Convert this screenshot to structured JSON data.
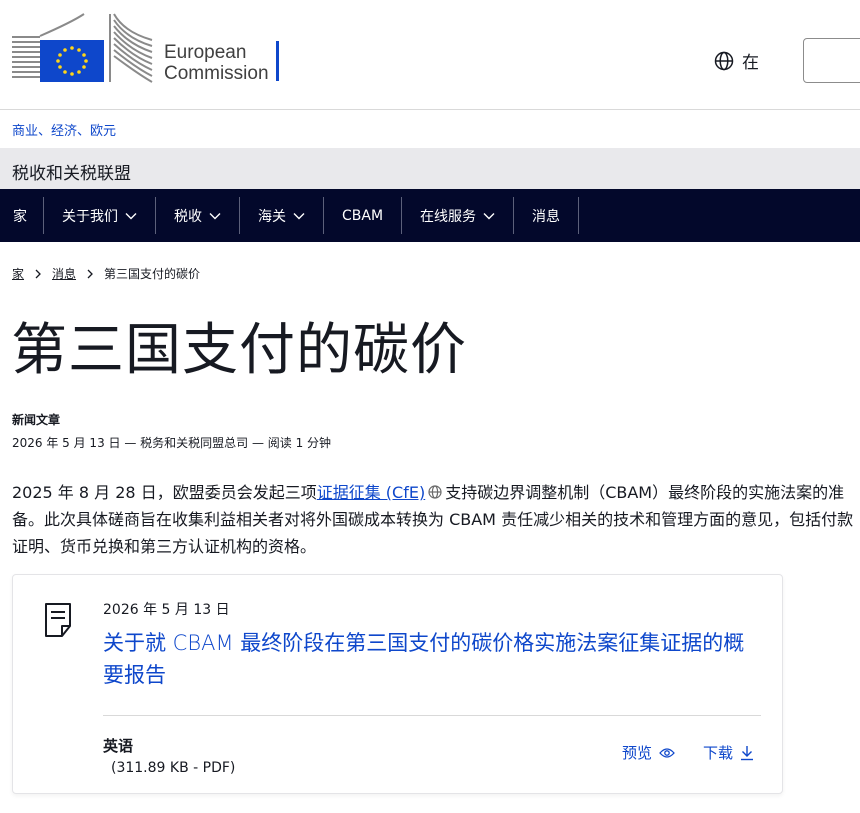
{
  "header": {
    "logo_line1": "European",
    "logo_line2": "Commission",
    "language_label": "在",
    "search_placeholder": ""
  },
  "site": {
    "parent_link": "商业、经济、欧元",
    "name": "税收和关税联盟"
  },
  "nav": {
    "items": [
      {
        "label": "家"
      },
      {
        "label": "关于我们"
      },
      {
        "label": "税收"
      },
      {
        "label": "海关"
      },
      {
        "label": "CBAM"
      },
      {
        "label": "在线服务"
      },
      {
        "label": "消息"
      }
    ]
  },
  "breadcrumb": {
    "home": "家",
    "news": "消息",
    "current": "第三国支付的碳价"
  },
  "article": {
    "title": "第三国支付的碳价",
    "type": "新闻文章",
    "meta": "2026 年 5 月 13 日 — 税务和关税同盟总司 — 阅读 1 分钟",
    "intro_before": "2025 年 8 月 28 日，欧盟委员会发起三项",
    "intro_link": "证据征集 (CfE)",
    "intro_after": "支持碳边界调整机制（CBAM）最终阶段的实施法案的准备。此次具体磋商旨在收集利益相关者对将外国碳成本转换为 CBAM 责任减少相关的技术和管理方面的意见，包括付款证明、货币兑换和第三方认证机构的资格。"
  },
  "file_card": {
    "date": "2026 年 5 月 13 日",
    "title": "关于就 CBAM 最终阶段在第三国支付的碳价格实施法案征集证据的概要报告",
    "language": "英语",
    "size": "(311.89 KB - PDF)",
    "preview_label": "预览",
    "download_label": "下载"
  },
  "colors": {
    "nav_background": "#03082b",
    "link_blue": "#0e47cb",
    "site_band": "#e9e9ec",
    "eu_blue": "#0e47cb",
    "eu_star": "#ffd617"
  }
}
